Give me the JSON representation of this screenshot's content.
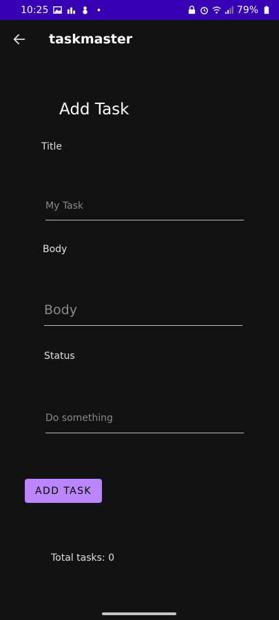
{
  "status_bar": {
    "time": "10:25",
    "battery": "79%",
    "bg_color": "#3700b3",
    "left_icons": [
      "gallery-icon",
      "chart-icon",
      "snowman-icon",
      "dot-icon"
    ],
    "right_icons": [
      "lock-icon",
      "alarm-icon",
      "wifi-icon",
      "signal-icon",
      "battery-icon"
    ]
  },
  "app_bar": {
    "title": "taskmaster",
    "back_icon": "back-arrow-icon"
  },
  "form": {
    "heading": "Add Task",
    "title_label": "Title",
    "title_placeholder": "My Task",
    "body_label": "Body",
    "body_placeholder": "Body",
    "status_label": "Status",
    "status_placeholder": "Do something"
  },
  "button": {
    "add_label": "ADD TASK",
    "color": "#bb86fc"
  },
  "footer": {
    "total_label": "Total tasks: 0"
  }
}
